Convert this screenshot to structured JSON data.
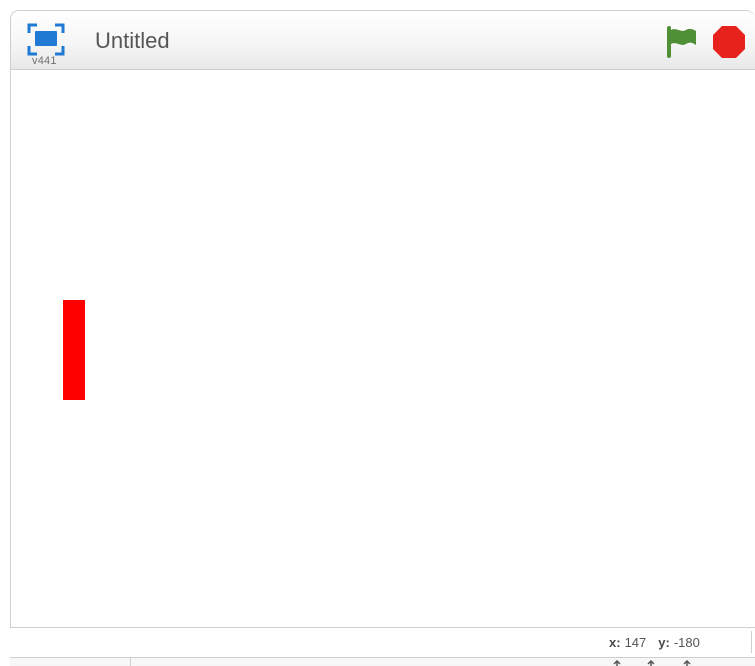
{
  "app": {
    "title": "Untitled",
    "version": "v441"
  },
  "controls": {
    "fullscreen_icon": "fullscreen-icon",
    "green_flag_icon": "green-flag-icon",
    "stop_icon": "stop-sign-icon",
    "accent_blue": "#1f7ad3",
    "flag_green": "#4f8f35",
    "stop_red": "#e7211c"
  },
  "stage": {
    "background": "#ffffff",
    "sprite_color": "#ff0000"
  },
  "mouse_readout": {
    "x_label": "x:",
    "x_value": "147",
    "y_label": "y:",
    "y_value": "-180"
  }
}
